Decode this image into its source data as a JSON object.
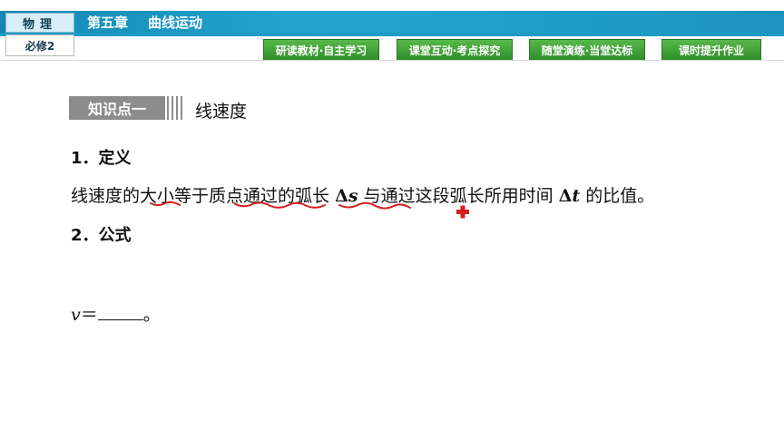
{
  "header": {
    "subject": "物理",
    "course": "必修2",
    "chapter": "第五章",
    "chapter_title": "曲线运动"
  },
  "nav": [
    {
      "label": "研读教材·自主学习"
    },
    {
      "label": "课堂互动·考点探究"
    },
    {
      "label": "随堂演练·当堂达标"
    },
    {
      "label": "课时提升作业"
    }
  ],
  "knowledge_point": {
    "badge": "知识点一",
    "title": "线速度"
  },
  "section1": {
    "heading": "1．定义",
    "text_a": "线速度的",
    "text_b": "大小",
    "text_c": "等于",
    "text_d": "质点通过的",
    "text_e": "弧长",
    "sym_s": "Δ",
    "sym_s_var": "s",
    "text_f": " 与通过这段弧长所用时间 ",
    "sym_t": "Δ",
    "sym_t_var": "t",
    "text_g": " 的比值。"
  },
  "section2": {
    "heading": "2．公式",
    "formula_var": "v",
    "formula_eq": "＝",
    "formula_end": "。"
  },
  "colors": {
    "header_blue": "#1d9bc4",
    "nav_green": "#3a9a33",
    "annotation_red": "#d61f1f"
  }
}
